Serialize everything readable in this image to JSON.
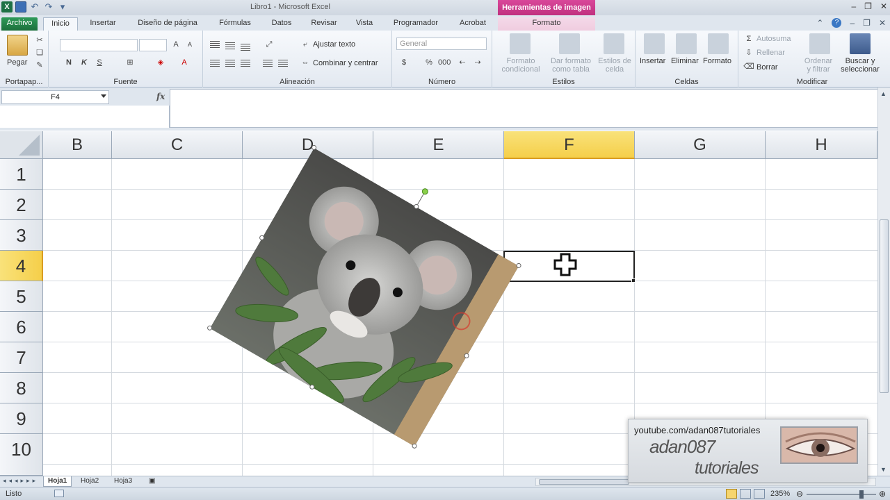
{
  "window": {
    "title": "Libro1  -  Microsoft Excel",
    "context_tab_group": "Herramientas de imagen"
  },
  "tabs": [
    {
      "label": "Archivo"
    },
    {
      "label": "Inicio"
    },
    {
      "label": "Insertar"
    },
    {
      "label": "Diseño de página"
    },
    {
      "label": "Fórmulas"
    },
    {
      "label": "Datos"
    },
    {
      "label": "Revisar"
    },
    {
      "label": "Vista"
    },
    {
      "label": "Programador"
    },
    {
      "label": "Acrobat"
    },
    {
      "label": "Formato"
    }
  ],
  "ribbon": {
    "portapapeles": {
      "label": "Portapap...",
      "paste": "Pegar"
    },
    "fuente": {
      "label": "Fuente",
      "bold": "N",
      "italic": "K",
      "underline": "S"
    },
    "alineacion": {
      "label": "Alineación",
      "wrap": "Ajustar texto",
      "merge": "Combinar y centrar"
    },
    "numero": {
      "label": "Número",
      "format": "General",
      "currency": "$",
      "percent": "%",
      "thousands": "000"
    },
    "estilos": {
      "label": "Estilos",
      "conditional": "Formato condicional",
      "table": "Dar formato como tabla",
      "cell_styles": "Estilos de celda"
    },
    "celdas": {
      "label": "Celdas",
      "insert": "Insertar",
      "delete": "Eliminar",
      "format": "Formato"
    },
    "modificar": {
      "label": "Modificar",
      "autosum": "Autosuma",
      "fill": "Rellenar",
      "clear": "Borrar",
      "sort": "Ordenar y filtrar",
      "find": "Buscar y seleccionar"
    }
  },
  "formula_bar": {
    "name_box": "F4",
    "fx": "fx",
    "formula": ""
  },
  "columns": [
    "B",
    "C",
    "D",
    "E",
    "F",
    "G",
    "H"
  ],
  "rows": [
    "1",
    "2",
    "3",
    "4",
    "5",
    "6",
    "7",
    "8",
    "9",
    "10"
  ],
  "selected_cell": {
    "column": "F",
    "row": "4"
  },
  "sheets": [
    {
      "label": "Hoja1"
    },
    {
      "label": "Hoja2"
    },
    {
      "label": "Hoja3"
    }
  ],
  "status": {
    "text": "Listo",
    "zoom": "235%"
  },
  "watermark": {
    "url": "youtube.com/adan087tutoriales",
    "name": "adan087",
    "sub": "tutoriales"
  }
}
